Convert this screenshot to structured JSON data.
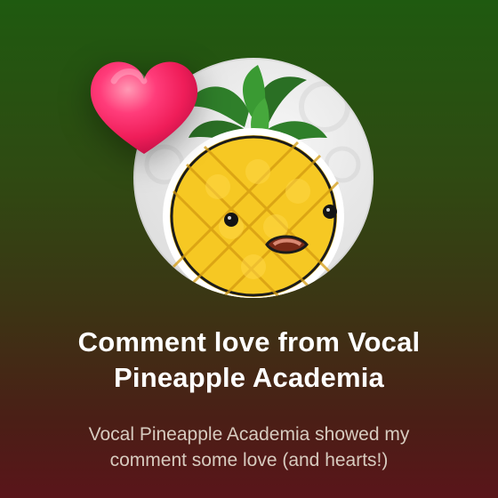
{
  "notification": {
    "title": "Comment love from Vocal Pineapple Academia",
    "subtitle": "Vocal Pineapple Academia showed my comment some love (and hearts!)"
  },
  "icons": {
    "heart": "heart-icon",
    "avatar": "pineapple-avatar"
  },
  "colors": {
    "title": "#ffffff",
    "subtitle": "#d7cbbf",
    "heart": "#ff2b6a",
    "background_top": "#1f5a10",
    "background_bottom": "#5a151a"
  }
}
